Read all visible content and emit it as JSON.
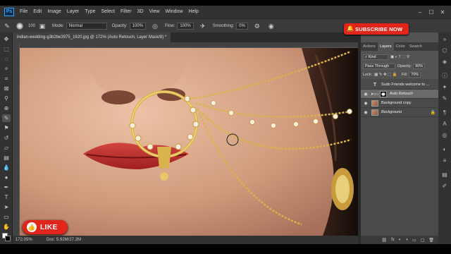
{
  "app": {
    "logo": "Ps"
  },
  "menu": [
    "File",
    "Edit",
    "Image",
    "Layer",
    "Type",
    "Select",
    "Filter",
    "3D",
    "View",
    "Window",
    "Help"
  ],
  "window_controls": [
    "–",
    "☐",
    "✕"
  ],
  "options": {
    "brush_size": "100",
    "mode_label": "Mode:",
    "mode_value": "Normal",
    "opacity_label": "Opacity:",
    "opacity_value": "100%",
    "flow_label": "Flow:",
    "flow_value": "100%",
    "smoothing_label": "Smoothing:",
    "smoothing_value": "0%"
  },
  "subscribe": {
    "label": "SUBSCRIBE NOW"
  },
  "document": {
    "tab_title": "indian-wedding-g3b2be3975_1920.jpg @ 172% (Auto Retouch, Layer Mask/8) *"
  },
  "status": {
    "zoom": "172.05%",
    "doc": "Doc: 5.92M/27.2M"
  },
  "like": {
    "label": "LIKE"
  },
  "panel": {
    "tabs": [
      "Actions",
      "Layers",
      "Color",
      "Swatch"
    ],
    "active_tab": "Layers",
    "kind_label": "Kind",
    "blend_mode": "Pass Through",
    "opacity_label": "Opacity:",
    "opacity_value": "90%",
    "lock_label": "Lock:",
    "fill_label": "Fill:",
    "fill_value": "70%"
  },
  "layers": [
    {
      "name": "Sudo Friends welcome to ...",
      "type": "text",
      "visible": false,
      "selected": false
    },
    {
      "name": "Auto Retouch",
      "type": "folder",
      "visible": true,
      "selected": true
    },
    {
      "name": "Background copy",
      "type": "image",
      "visible": true,
      "selected": false
    },
    {
      "name": "Background",
      "type": "image",
      "visible": true,
      "selected": false,
      "locked": true
    }
  ],
  "layers_footer": [
    "⛓",
    "fx",
    "◐",
    "◑",
    "▭",
    "▢",
    "🗑"
  ],
  "colors": {
    "accent_red": "#e1251b",
    "ps_blue": "#31a8ff",
    "panel_bg": "#535353"
  }
}
